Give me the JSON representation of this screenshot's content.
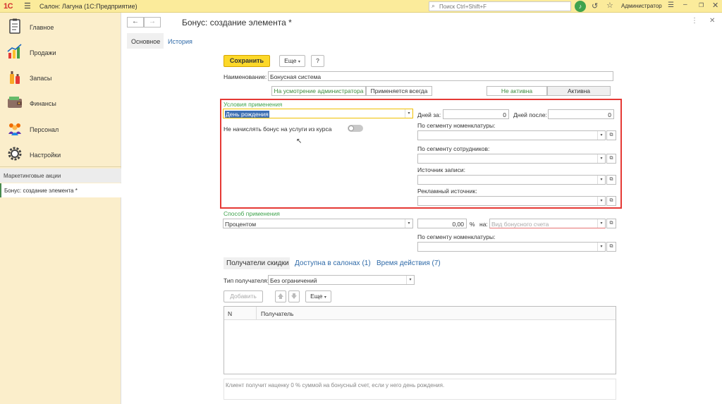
{
  "topbar": {
    "logo": "1С",
    "app_title": "Салон: Лагуна  (1С:Предприятие)",
    "search_placeholder": "Поиск Ctrl+Shift+F",
    "user": "Администратор"
  },
  "sidebar": {
    "sections": [
      {
        "label": "Главное",
        "icon": "clipboard-icon"
      },
      {
        "label": "Продажи",
        "icon": "sales-chart-icon"
      },
      {
        "label": "Запасы",
        "icon": "bottles-icon"
      },
      {
        "label": "Финансы",
        "icon": "wallet-icon"
      },
      {
        "label": "Персонал",
        "icon": "people-icon"
      },
      {
        "label": "Настройки",
        "icon": "gear-icon"
      }
    ],
    "list_item": "Маркетинговые акции",
    "open_item": "Бонус: создание элемента *"
  },
  "form": {
    "title": "Бонус: создание элемента *",
    "tabs": {
      "main": "Основное",
      "history": "История"
    },
    "toolbar": {
      "save": "Сохранить",
      "more": "Еще",
      "help": "?"
    },
    "name_label": "Наименование:",
    "name_value": "Бонусная система",
    "mode_options": [
      "На усмотрение администратора",
      "Применяется всегда"
    ],
    "state_options": [
      "Не активна",
      "Активна"
    ],
    "conditions": {
      "title": "Условия применения",
      "condition_value": "День рождения",
      "no_bonus_label": "Не начислять бонус на услуги из курса",
      "days_before_label": "Дней за:",
      "days_before_value": "0",
      "days_after_label": "Дней после:",
      "days_after_value": "0",
      "nomenclature_label": "По сегменту номенклатуры:",
      "employees_label": "По сегменту сотрудников:",
      "record_source_label": "Источник записи:",
      "ad_source_label": "Рекламный источник:"
    },
    "method": {
      "title": "Способ применения",
      "method_value": "Процентом",
      "amount_value": "0,00",
      "percent_sign": "%",
      "to_label": "на:",
      "account_placeholder": "Вид бонусного счета",
      "nomenclature_label": "По сегменту номенклатуры:"
    },
    "bottom_tabs": [
      "Получатели скидки",
      "Доступна в салонах (1)",
      "Время действия (7)"
    ],
    "recipient_type_label": "Тип получателя:",
    "recipient_type_value": "Без ограничений",
    "add_button": "Добавить",
    "more_button": "Еще",
    "table_headers": [
      "N",
      "Получатель"
    ],
    "info_text": "Клиент получит наценку 0 % суммой на бонусный счет, если у него день рождения."
  },
  "colors": {
    "accent_yellow": "#fcd829",
    "highlight_red": "#e53935",
    "group_green": "#3fa34d",
    "link_blue": "#2f6aa8"
  }
}
